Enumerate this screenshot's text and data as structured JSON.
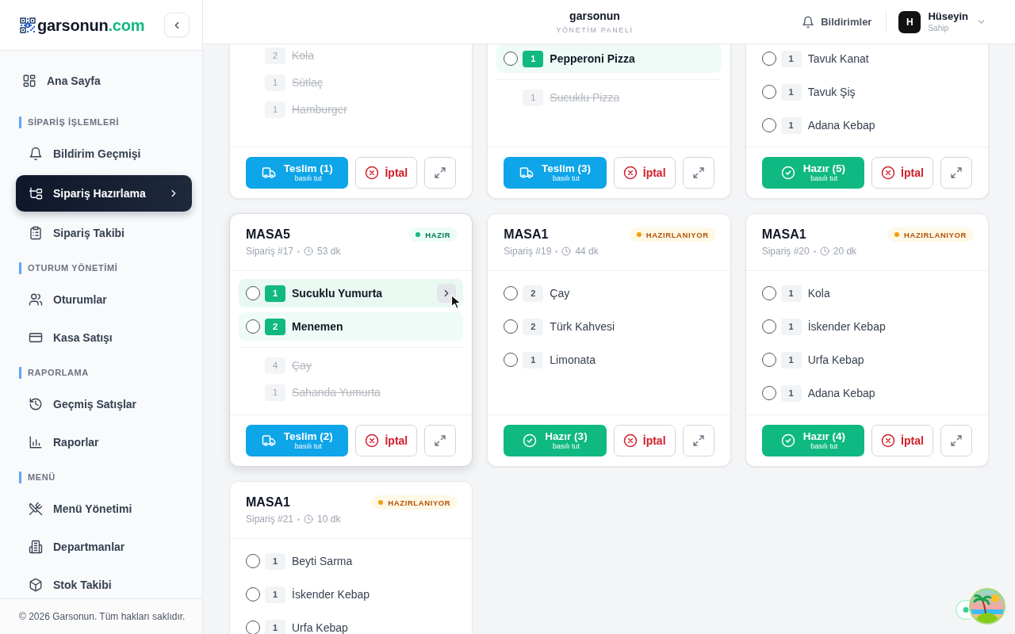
{
  "sidebar": {
    "logo": {
      "name": "garsonun",
      "domain": ".com"
    },
    "items": [
      {
        "label": "Ana Sayfa",
        "selected": false
      }
    ],
    "sections": [
      {
        "title": "SİPARİŞ İŞLEMLERİ",
        "items": [
          {
            "label": "Bildirim Geçmişi",
            "selected": false
          },
          {
            "label": "Sipariş Hazırlama",
            "selected": true
          },
          {
            "label": "Sipariş Takibi",
            "selected": false
          }
        ]
      },
      {
        "title": "OTURUM YÖNETİMİ",
        "items": [
          {
            "label": "Oturumlar",
            "selected": false
          },
          {
            "label": "Kasa Satışı",
            "selected": false
          }
        ]
      },
      {
        "title": "RAPORLAMA",
        "items": [
          {
            "label": "Geçmiş Satışlar",
            "selected": false
          },
          {
            "label": "Raporlar",
            "selected": false
          }
        ]
      },
      {
        "title": "MENÜ",
        "items": [
          {
            "label": "Menü Yönetimi",
            "selected": false
          },
          {
            "label": "Departmanlar",
            "selected": false
          },
          {
            "label": "Stok Takibi",
            "selected": false
          }
        ]
      }
    ],
    "footer": "© 2026 Garsonun. Tüm hakları saklıdır."
  },
  "header": {
    "title": "garsonun",
    "subtitle": "YÖNETİM PANELİ",
    "notifications": "Bildirimler",
    "user": {
      "initial": "H",
      "name": "Hüseyin",
      "role": "Sahip"
    }
  },
  "orders": [
    {
      "delivered": [
        {
          "qty": "2",
          "name": "Kola"
        },
        {
          "qty": "1",
          "name": "Sütlaç"
        },
        {
          "qty": "1",
          "name": "Hamburger"
        }
      ],
      "action": {
        "kind": "deliver",
        "label": "Teslim (1)",
        "hint": "basılı tut"
      },
      "cancel": "İptal"
    },
    {
      "items": [
        {
          "qty": "1",
          "name": "Pepperoni Pizza",
          "ready": true,
          "checked": false,
          "hovered": false
        }
      ],
      "delivered": [
        {
          "qty": "1",
          "name": "Sucuklu Pizza"
        }
      ],
      "action": {
        "kind": "deliver",
        "label": "Teslim (3)",
        "hint": "basılı tut"
      },
      "cancel": "İptal"
    },
    {
      "items": [
        {
          "qty": "1",
          "name": "Tavuk Kanat",
          "ready": false,
          "checked": false,
          "hovered": false
        },
        {
          "qty": "1",
          "name": "Tavuk Şiş",
          "ready": false,
          "checked": false,
          "hovered": false
        },
        {
          "qty": "1",
          "name": "Adana Kebap",
          "ready": false,
          "checked": false,
          "hovered": false
        }
      ],
      "action": {
        "kind": "ready",
        "label": "Hazır (5)",
        "hint": "basılı tut"
      },
      "cancel": "İptal"
    },
    {
      "table": "MASA5",
      "order": "Sipariş #17",
      "elapsed": "53 dk",
      "status": {
        "label": "HAZIR",
        "kind": "ready"
      },
      "items": [
        {
          "qty": "1",
          "name": "Sucuklu Yumurta",
          "ready": true,
          "checked": false,
          "hovered": true
        },
        {
          "qty": "2",
          "name": "Menemen",
          "ready": true,
          "checked": false,
          "hovered": false
        }
      ],
      "delivered": [
        {
          "qty": "4",
          "name": "Çay"
        },
        {
          "qty": "1",
          "name": "Sahanda Yumurta"
        }
      ],
      "action": {
        "kind": "deliver",
        "label": "Teslim (2)",
        "hint": "basılı tut"
      },
      "cancel": "İptal"
    },
    {
      "table": "MASA1",
      "order": "Sipariş #19",
      "elapsed": "44 dk",
      "status": {
        "label": "HAZIRLANIYOR",
        "kind": "preparing"
      },
      "items": [
        {
          "qty": "2",
          "name": "Çay",
          "ready": false,
          "checked": false,
          "hovered": false
        },
        {
          "qty": "2",
          "name": "Türk Kahvesi",
          "ready": false,
          "checked": false,
          "hovered": false
        },
        {
          "qty": "1",
          "name": "Limonata",
          "ready": false,
          "checked": false,
          "hovered": false
        }
      ],
      "action": {
        "kind": "ready",
        "label": "Hazır (3)",
        "hint": "basılı tut"
      },
      "cancel": "İptal"
    },
    {
      "table": "MASA1",
      "order": "Sipariş #20",
      "elapsed": "20 dk",
      "status": {
        "label": "HAZIRLANIYOR",
        "kind": "preparing"
      },
      "items": [
        {
          "qty": "1",
          "name": "Kola",
          "ready": false,
          "checked": false,
          "hovered": false
        },
        {
          "qty": "1",
          "name": "İskender Kebap",
          "ready": false,
          "checked": false,
          "hovered": false
        },
        {
          "qty": "1",
          "name": "Urfa Kebap",
          "ready": false,
          "checked": false,
          "hovered": false
        },
        {
          "qty": "1",
          "name": "Adana Kebap",
          "ready": false,
          "checked": false,
          "hovered": false
        }
      ],
      "action": {
        "kind": "ready",
        "label": "Hazır (4)",
        "hint": "basılı tut"
      },
      "cancel": "İptal"
    },
    {
      "table": "MASA1",
      "order": "Sipariş #21",
      "elapsed": "10 dk",
      "status": {
        "label": "HAZIRLANIYOR",
        "kind": "preparing"
      },
      "items": [
        {
          "qty": "1",
          "name": "Beyti Sarma",
          "ready": false,
          "checked": false,
          "hovered": false
        },
        {
          "qty": "1",
          "name": "İskender Kebap",
          "ready": false,
          "checked": false,
          "hovered": false
        },
        {
          "qty": "1",
          "name": "Urfa Kebap",
          "ready": false,
          "checked": false,
          "hovered": false
        }
      ]
    }
  ]
}
